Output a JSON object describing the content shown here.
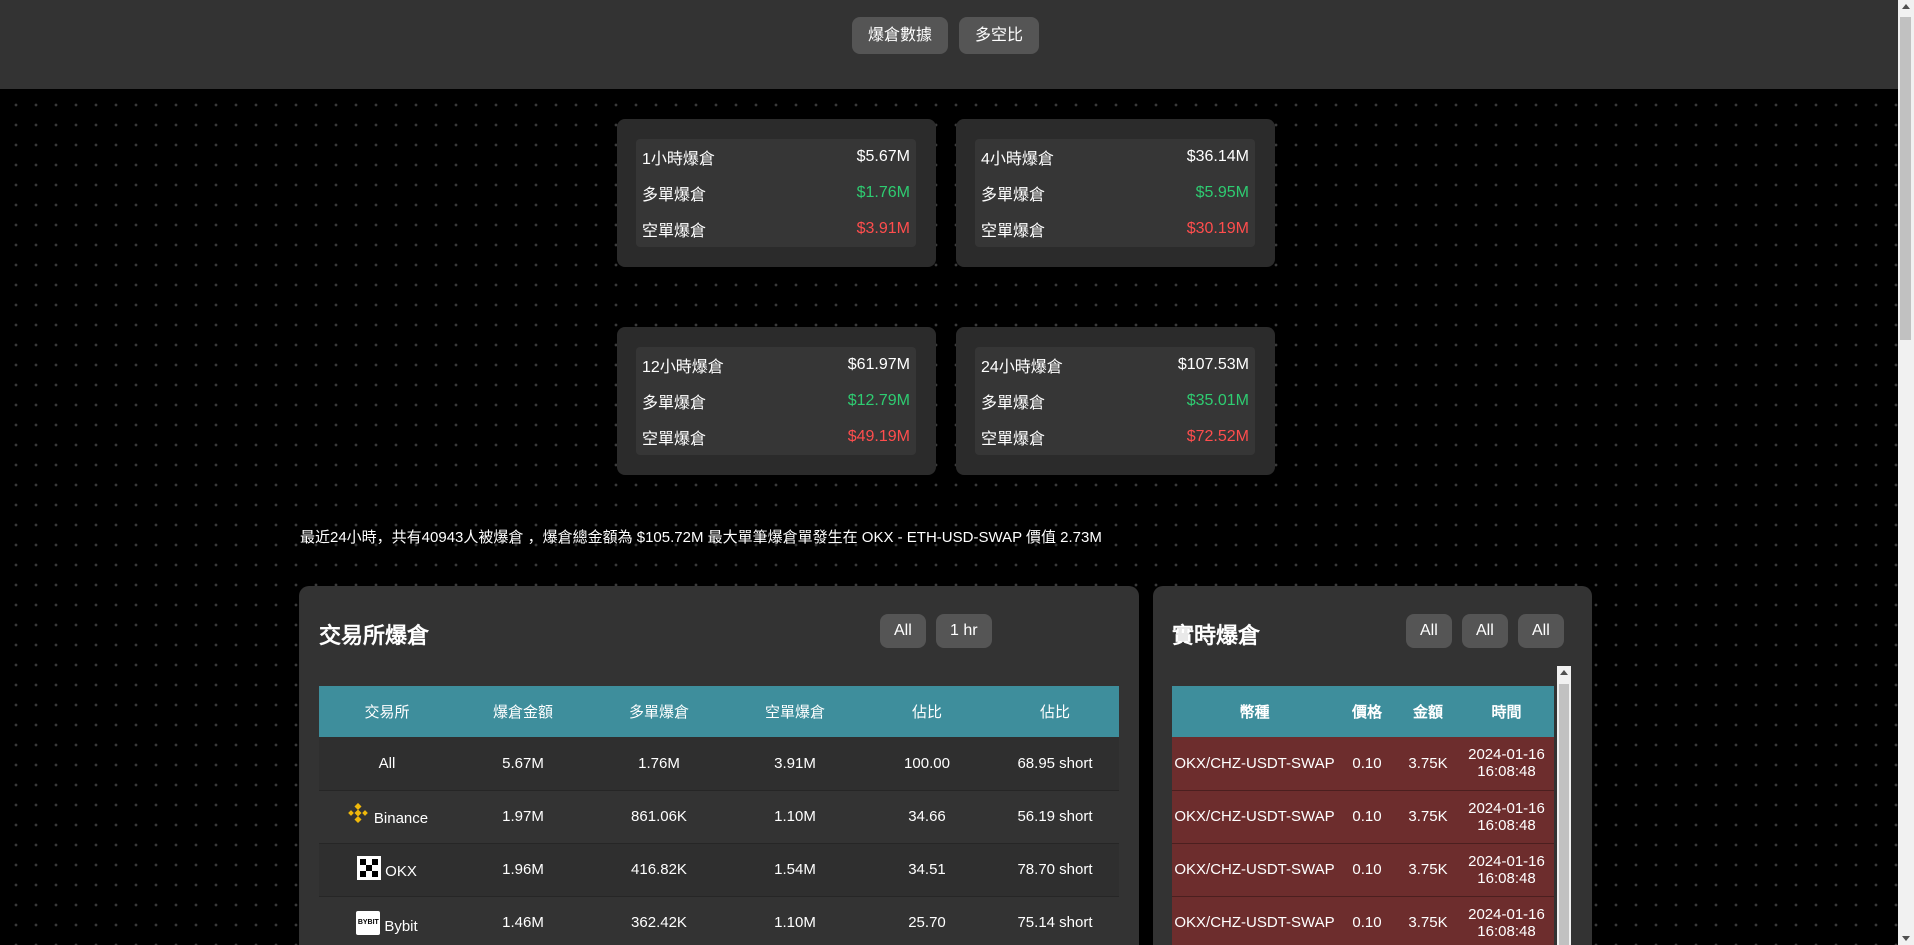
{
  "nav": {
    "buttons": [
      "爆倉數據",
      "多空比"
    ]
  },
  "cards": [
    {
      "rows": [
        {
          "label": "1小時爆倉",
          "value": "$5.67M",
          "tone": "white"
        },
        {
          "label": "多單爆倉",
          "value": "$1.76M",
          "tone": "green"
        },
        {
          "label": "空單爆倉",
          "value": "$3.91M",
          "tone": "red"
        }
      ]
    },
    {
      "rows": [
        {
          "label": "4小時爆倉",
          "value": "$36.14M",
          "tone": "white"
        },
        {
          "label": "多單爆倉",
          "value": "$5.95M",
          "tone": "green"
        },
        {
          "label": "空單爆倉",
          "value": "$30.19M",
          "tone": "red"
        }
      ]
    },
    {
      "rows": [
        {
          "label": "12小時爆倉",
          "value": "$61.97M",
          "tone": "white"
        },
        {
          "label": "多單爆倉",
          "value": "$12.79M",
          "tone": "green"
        },
        {
          "label": "空單爆倉",
          "value": "$49.19M",
          "tone": "red"
        }
      ]
    },
    {
      "rows": [
        {
          "label": "24小時爆倉",
          "value": "$107.53M",
          "tone": "white"
        },
        {
          "label": "多單爆倉",
          "value": "$35.01M",
          "tone": "green"
        },
        {
          "label": "空單爆倉",
          "value": "$72.52M",
          "tone": "red"
        }
      ]
    }
  ],
  "summary": "最近24小時，共有40943人被爆倉 ，爆倉總金額為 $105.72M 最大單筆爆倉單發生在 OKX - ETH-USD-SWAP 價值 2.73M",
  "exchange_panel": {
    "title": "交易所爆倉",
    "filters": [
      "All",
      "1 hr"
    ],
    "columns": [
      "交易所",
      "爆倉金額",
      "多單爆倉",
      "空單爆倉",
      "佔比",
      "佔比"
    ],
    "rows": [
      {
        "exchange": "All",
        "logo": "",
        "amount": "5.67M",
        "long": "1.76M",
        "short": "3.91M",
        "share": "100.00",
        "ratio": "68.95 short"
      },
      {
        "exchange": "Binance",
        "logo": "binance-logo",
        "amount": "1.97M",
        "long": "861.06K",
        "short": "1.10M",
        "share": "34.66",
        "ratio": "56.19 short"
      },
      {
        "exchange": "OKX",
        "logo": "okx-logo",
        "amount": "1.96M",
        "long": "416.82K",
        "short": "1.54M",
        "share": "34.51",
        "ratio": "78.70 short"
      },
      {
        "exchange": "Bybit",
        "logo": "bybit-logo",
        "amount": "1.46M",
        "long": "362.42K",
        "short": "1.10M",
        "share": "25.70",
        "ratio": "75.14 short"
      }
    ],
    "bybit_logo_text": "BYBIT"
  },
  "realtime_panel": {
    "title": "實時爆倉",
    "filters": [
      "All",
      "All",
      "All"
    ],
    "columns": [
      "幣種",
      "價格",
      "金額",
      "時間"
    ],
    "rows": [
      {
        "symbol": "OKX/CHZ-USDT-SWAP",
        "price": "0.10",
        "amount": "3.75K",
        "time": "2024-01-16 16:08:48"
      },
      {
        "symbol": "OKX/CHZ-USDT-SWAP",
        "price": "0.10",
        "amount": "3.75K",
        "time": "2024-01-16 16:08:48"
      },
      {
        "symbol": "OKX/CHZ-USDT-SWAP",
        "price": "0.10",
        "amount": "3.75K",
        "time": "2024-01-16 16:08:48"
      },
      {
        "symbol": "OKX/CHZ-USDT-SWAP",
        "price": "0.10",
        "amount": "3.75K",
        "time": "2024-01-16 16:08:48"
      }
    ]
  },
  "colors": {
    "long": "#2ecc71",
    "short": "#ff4d4d",
    "header": "#3e8e9c",
    "realtime_row": "#6d2d2d"
  }
}
